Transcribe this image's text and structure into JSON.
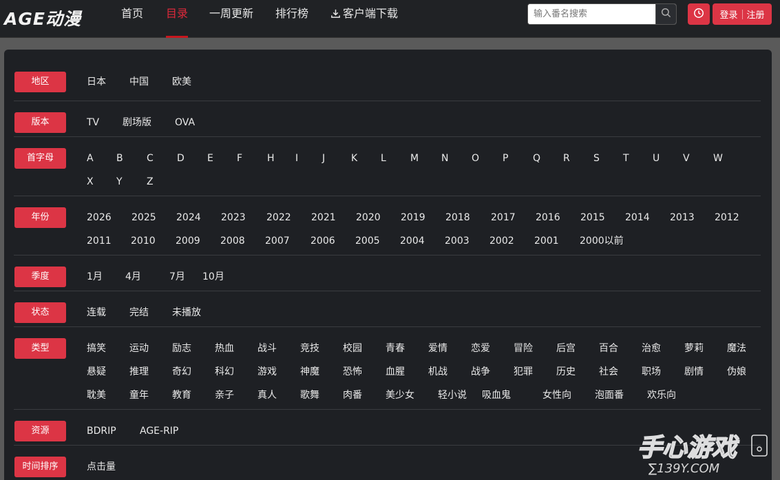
{
  "header": {
    "logo": "AGE动漫",
    "nav": [
      {
        "label": "首页",
        "active": false
      },
      {
        "label": "目录",
        "active": true
      },
      {
        "label": "一周更新",
        "active": false
      },
      {
        "label": "排行榜",
        "active": false
      },
      {
        "label": "客户端下载",
        "active": false,
        "icon": "download-icon"
      }
    ],
    "search": {
      "placeholder": "输入番名搜索",
      "value": ""
    },
    "history_icon": "clock-icon",
    "login_label": "登录",
    "register_label": "注册"
  },
  "filters": [
    {
      "label": "地区",
      "options": [
        "日本",
        "中国",
        "欧美"
      ]
    },
    {
      "label": "版本",
      "options": [
        "TV",
        "剧场版",
        "OVA"
      ]
    },
    {
      "label": "首字母",
      "options": [
        "A",
        "B",
        "C",
        "D",
        "E",
        "F",
        "H",
        "I",
        "J",
        "K",
        "L",
        "M",
        "N",
        "O",
        "P",
        "Q",
        "R",
        "S",
        "T",
        "U",
        "V",
        "W",
        "X",
        "Y",
        "Z"
      ]
    },
    {
      "label": "年份",
      "options": [
        "2026",
        "2025",
        "2024",
        "2023",
        "2022",
        "2021",
        "2020",
        "2019",
        "2018",
        "2017",
        "2016",
        "2015",
        "2014",
        "2013",
        "2012",
        "2011",
        "2010",
        "2009",
        "2008",
        "2007",
        "2006",
        "2005",
        "2004",
        "2003",
        "2002",
        "2001",
        "2000以前"
      ]
    },
    {
      "label": "季度",
      "options": [
        "1月",
        "4月",
        "7月",
        "10月"
      ]
    },
    {
      "label": "状态",
      "options": [
        "连载",
        "完结",
        "未播放"
      ]
    },
    {
      "label": "类型",
      "options": [
        "搞笑",
        "运动",
        "励志",
        "热血",
        "战斗",
        "竞技",
        "校园",
        "青春",
        "爱情",
        "恋爱",
        "冒险",
        "后宫",
        "百合",
        "治愈",
        "萝莉",
        "魔法",
        "悬疑",
        "推理",
        "奇幻",
        "科幻",
        "游戏",
        "神魔",
        "恐怖",
        "血腥",
        "机战",
        "战争",
        "犯罪",
        "历史",
        "社会",
        "职场",
        "剧情",
        "伪娘",
        "耽美",
        "童年",
        "教育",
        "亲子",
        "真人",
        "歌舞",
        "肉番",
        "美少女",
        "轻小说",
        "吸血鬼",
        "女性向",
        "泡面番",
        "欢乐向"
      ]
    },
    {
      "label": "资源",
      "options": [
        "BDRIP",
        "AGE-RIP"
      ]
    },
    {
      "label": "时间排序",
      "options": [
        "点击量"
      ]
    }
  ],
  "watermark": {
    "main": "手心游戏",
    "sub": "∑139Y.COM"
  },
  "colors": {
    "accent": "#dc3545",
    "active_nav": "#e0293b",
    "panel_bg": "#1e2024",
    "header_bg": "#202225"
  }
}
